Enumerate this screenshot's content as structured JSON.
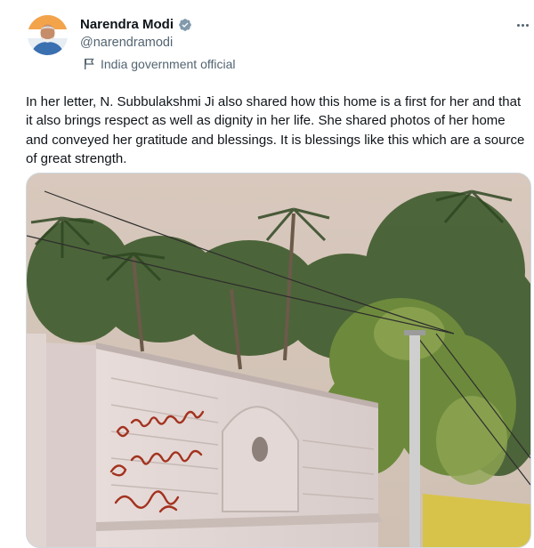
{
  "author": {
    "display_name": "Narendra Modi",
    "handle": "@narendramodi",
    "label": "India government official",
    "avatar_icon": "profile-photo",
    "verified_icon": "verified-badge-icon",
    "label_icon": "flag-icon"
  },
  "menu_icon": "more-options-icon",
  "tweet": {
    "text": "In her letter, N. Subbulakshmi Ji also shared how this home is a first for her and that it also brings respect as well as dignity in her life. She shared photos of her home and conveyed her gratitude and blessings. It is blessings like this which are a source of great strength."
  },
  "colors": {
    "text_primary": "#0f1419",
    "text_secondary": "#536471",
    "verified_blue": "#1d9bf0",
    "border": "#cfd9de"
  }
}
